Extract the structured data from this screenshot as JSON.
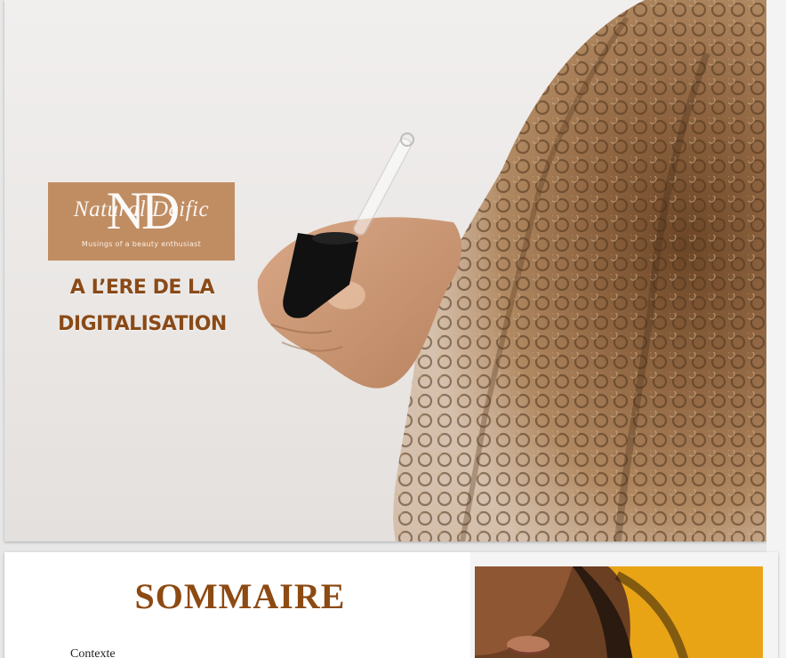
{
  "cover": {
    "logo": {
      "monogram": "ND",
      "script": "Natural Deific",
      "tagline": "Musings of a beauty enthusiast"
    },
    "title_line1": "A L’ERE DE LA",
    "title_line2": "DIGITALISATION"
  },
  "sommaire": {
    "title": "SOMMAIRE",
    "first_item": "Contexte"
  },
  "colors": {
    "brand_brown": "#8a4a17",
    "logo_tan": "#c08d63",
    "portrait_yellow": "#e9a416"
  }
}
